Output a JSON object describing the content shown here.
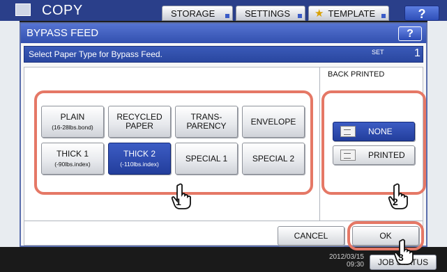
{
  "background": {
    "title": "COPY",
    "tabs": [
      "STORAGE",
      "SETTINGS",
      "TEMPLATE"
    ],
    "help_label": "?",
    "datetime_date": "2012/03/15",
    "datetime_time": "09:30",
    "bottom_button": "JOB STATUS"
  },
  "dialog": {
    "title": "BYPASS FEED",
    "help_label": "?",
    "message": "Select Paper Type for Bypass Feed.",
    "set_label": "SET",
    "set_count": "1",
    "paper_types": [
      {
        "main": "PLAIN",
        "sub": "(16-28lbs.bond)",
        "selected": false
      },
      {
        "main": "RECYCLED PAPER",
        "sub": "",
        "selected": false
      },
      {
        "main": "TRANS- PARENCY",
        "sub": "",
        "selected": false
      },
      {
        "main": "ENVELOPE",
        "sub": "",
        "selected": false
      },
      {
        "main": "THICK 1",
        "sub": "(-90lbs.index)",
        "selected": false
      },
      {
        "main": "THICK 2",
        "sub": "(-110lbs.index)",
        "selected": true
      },
      {
        "main": "SPECIAL 1",
        "sub": "",
        "selected": false
      },
      {
        "main": "SPECIAL 2",
        "sub": "",
        "selected": false
      }
    ],
    "back_printed": {
      "label": "BACK PRINTED",
      "none": "NONE",
      "printed": "PRINTED",
      "selected": "NONE"
    },
    "cancel_label": "CANCEL",
    "ok_label": "OK"
  },
  "callouts": [
    "1",
    "2",
    "3"
  ],
  "colors": {
    "accent_blue": "#2a47a0",
    "highlight": "#e57866",
    "selected_button": "#233e9c"
  }
}
